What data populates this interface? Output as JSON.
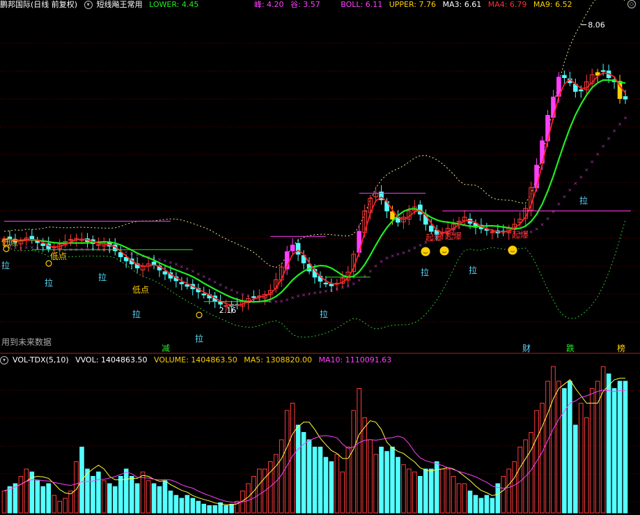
{
  "header": {
    "stock": "鹏邦国际",
    "mode": "(日线 前复权)",
    "indicator": "短线飚王常用",
    "lower": "LOWER: 4.45",
    "peak": "峰: 4.20",
    "valley": "谷: 3.57",
    "boll": "BOLL: 6.11",
    "upper": "UPPER: 7.76",
    "ma3": "MA3: 6.61",
    "ma4": "MA4: 6.79",
    "ma9": "MA9: 6.52"
  },
  "vol_header": {
    "name": "VOL-TDX(5,10)",
    "vvol": "VVOL: 1404863.50",
    "volume": "VOLUME: 1404863.50",
    "ma5": "MA5: 1308820.00",
    "ma10": "MA10: 1110091.63"
  },
  "colors": {
    "up": "#ff3c3c",
    "down": "#54ffff",
    "ma_red": "#ff2020",
    "ma_green": "#20ee20",
    "magenta": "#ff40ff",
    "yellow": "#ffd000",
    "ma5": "#ffff40",
    "ma10": "#ff40ff"
  },
  "chart_data": {
    "type": "candlestick",
    "price_labels": {
      "high": "8.06",
      "low": "2.16"
    },
    "annotations": [
      "低点",
      "低点",
      "低点",
      "拉",
      "拉",
      "拉",
      "拉",
      "拉",
      "拉",
      "拉",
      "拉",
      "拉",
      "起爆",
      "起爆",
      "起爆",
      "减",
      "财",
      "跌",
      "榜"
    ],
    "footnote": "用到未来数据",
    "close": [
      3.85,
      3.83,
      3.79,
      3.81,
      3.87,
      3.84,
      3.78,
      3.72,
      3.66,
      3.7,
      3.74,
      3.8,
      3.84,
      3.86,
      3.84,
      3.8,
      3.76,
      3.74,
      3.76,
      3.71,
      3.62,
      3.5,
      3.42,
      3.36,
      3.28,
      3.31,
      3.36,
      3.34,
      3.24,
      3.16,
      3.08,
      3.03,
      2.97,
      2.92,
      2.87,
      2.81,
      2.75,
      2.69,
      2.63,
      2.57,
      2.54,
      2.53,
      2.56,
      2.62,
      2.68,
      2.7,
      2.73,
      2.76,
      2.84,
      3.05,
      3.3,
      3.6,
      3.73,
      3.55,
      3.38,
      3.22,
      3.1,
      3.02,
      2.97,
      2.93,
      2.98,
      3.08,
      3.2,
      3.55,
      4.0,
      4.4,
      4.65,
      4.75,
      4.62,
      4.4,
      4.24,
      4.18,
      4.28,
      4.4,
      4.48,
      4.34,
      4.14,
      4.0,
      3.94,
      3.98,
      4.06,
      4.14,
      4.2,
      4.28,
      4.16,
      4.08,
      4.05,
      4.02,
      3.99,
      3.97,
      4.0,
      4.06,
      4.14,
      4.24,
      4.45,
      4.86,
      5.3,
      5.78,
      6.28,
      6.64,
      7.03,
      7.02,
      6.92,
      6.75,
      6.76,
      6.94,
      7.08,
      7.12,
      7.15,
      7.02,
      6.94,
      6.61,
      6.6
    ],
    "volume": [
      0.15,
      0.18,
      0.2,
      0.25,
      0.3,
      0.28,
      0.22,
      0.18,
      0.2,
      0.12,
      0.08,
      0.1,
      0.15,
      0.35,
      0.45,
      0.3,
      0.25,
      0.28,
      0.22,
      0.2,
      0.18,
      0.25,
      0.3,
      0.25,
      0.2,
      0.28,
      0.22,
      0.2,
      0.18,
      0.22,
      0.15,
      0.12,
      0.1,
      0.12,
      0.1,
      0.08,
      0.06,
      0.05,
      0.05,
      0.07,
      0.05,
      0.06,
      0.08,
      0.15,
      0.2,
      0.25,
      0.3,
      0.3,
      0.35,
      0.4,
      0.5,
      0.7,
      0.75,
      0.6,
      0.55,
      0.5,
      0.45,
      0.45,
      0.38,
      0.35,
      0.4,
      0.28,
      0.45,
      0.7,
      0.85,
      0.65,
      0.5,
      0.4,
      0.45,
      0.42,
      0.45,
      0.38,
      0.33,
      0.3,
      0.28,
      0.25,
      0.3,
      0.3,
      0.35,
      0.3,
      0.3,
      0.25,
      0.2,
      0.2,
      0.15,
      0.12,
      0.1,
      0.12,
      0.1,
      0.2,
      0.25,
      0.3,
      0.35,
      0.45,
      0.5,
      0.55,
      0.7,
      0.75,
      0.9,
      1.0,
      0.9,
      0.85,
      0.9,
      0.6,
      0.75,
      0.65,
      0.85,
      0.9,
      1.0,
      0.95,
      0.85,
      0.9,
      0.9
    ]
  }
}
